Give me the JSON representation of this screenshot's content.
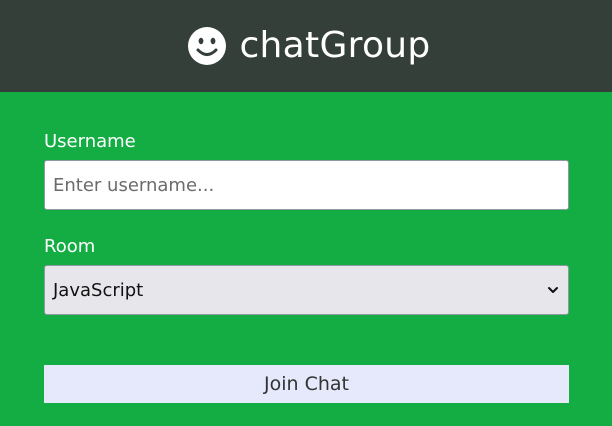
{
  "header": {
    "icon": "smile-icon",
    "title": "chatGroup"
  },
  "form": {
    "username": {
      "label": "Username",
      "value": "",
      "placeholder": "Enter username..."
    },
    "room": {
      "label": "Room",
      "selected": "JavaScript",
      "icon": "chevron-down-icon"
    },
    "submit_label": "Join Chat"
  },
  "colors": {
    "header_bg": "#353f3a",
    "main_bg": "#13ad44",
    "button_bg": "#e6e8fb",
    "select_bg": "#e7e6eb"
  }
}
